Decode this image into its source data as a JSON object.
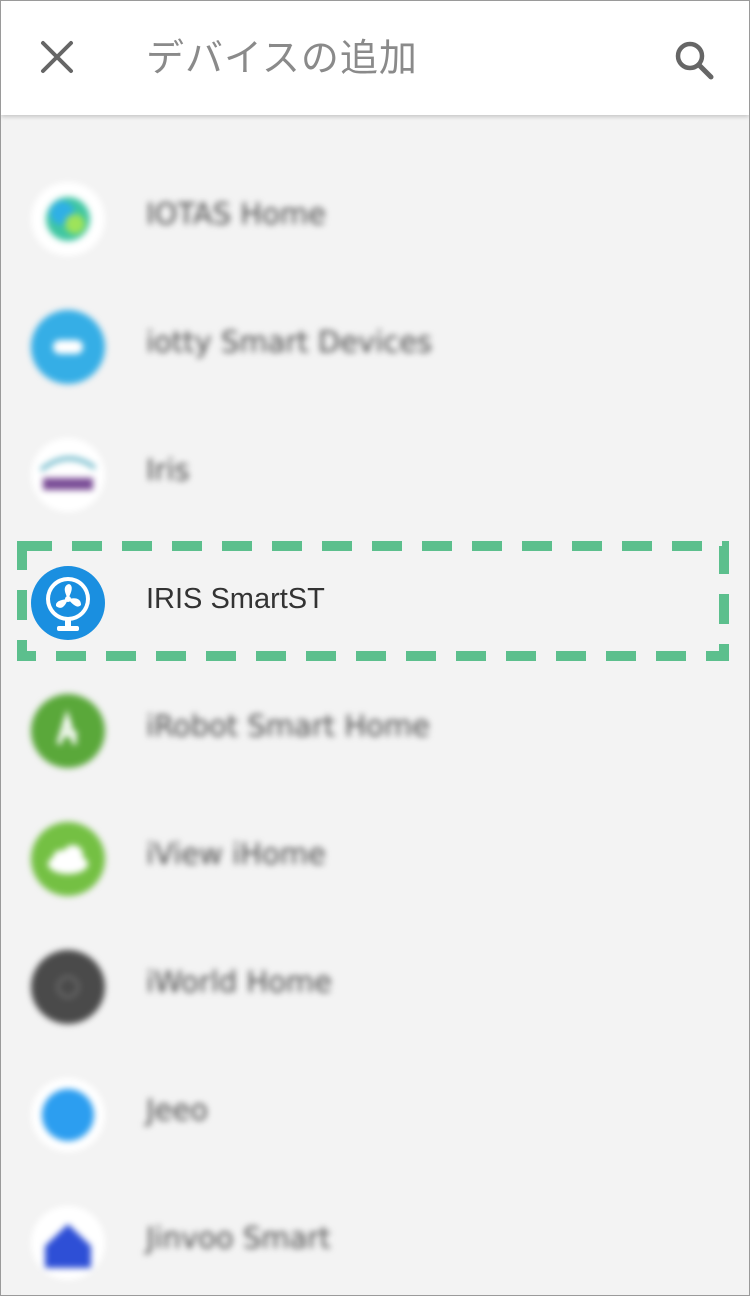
{
  "header": {
    "title": "デバイスの追加",
    "close_icon": "close-icon",
    "search_icon": "search-icon"
  },
  "list": {
    "items": [
      {
        "label": "",
        "icon": "green-circle-icon",
        "color": "#8cc06a"
      },
      {
        "label": "IOTAS Home",
        "icon": "iotas-logo-icon",
        "color": "#3fc6a2"
      },
      {
        "label": "iotty Smart Devices",
        "icon": "iotty-logo-icon",
        "color": "#35aee6"
      },
      {
        "label": "Iris",
        "icon": "iris-logo-icon",
        "color": "#7a4c96"
      },
      {
        "label": "IRIS SmartST",
        "icon": "fan-icon",
        "color": "#1a8fe0"
      },
      {
        "label": "iRobot Smart Home",
        "icon": "irobot-logo-icon",
        "color": "#5aa83a"
      },
      {
        "label": "iView iHome",
        "icon": "iview-cloud-icon",
        "color": "#74c043"
      },
      {
        "label": "iWorld Home",
        "icon": "iworld-logo-icon",
        "color": "#4a4a4a"
      },
      {
        "label": "Jeeo",
        "icon": "jeeo-logo-icon",
        "color": "#2c9ef0"
      },
      {
        "label": "Jinvoo Smart",
        "icon": "jinvoo-house-icon",
        "color": "#2e4fd6"
      }
    ]
  },
  "highlight_color": "#5cbf8d"
}
